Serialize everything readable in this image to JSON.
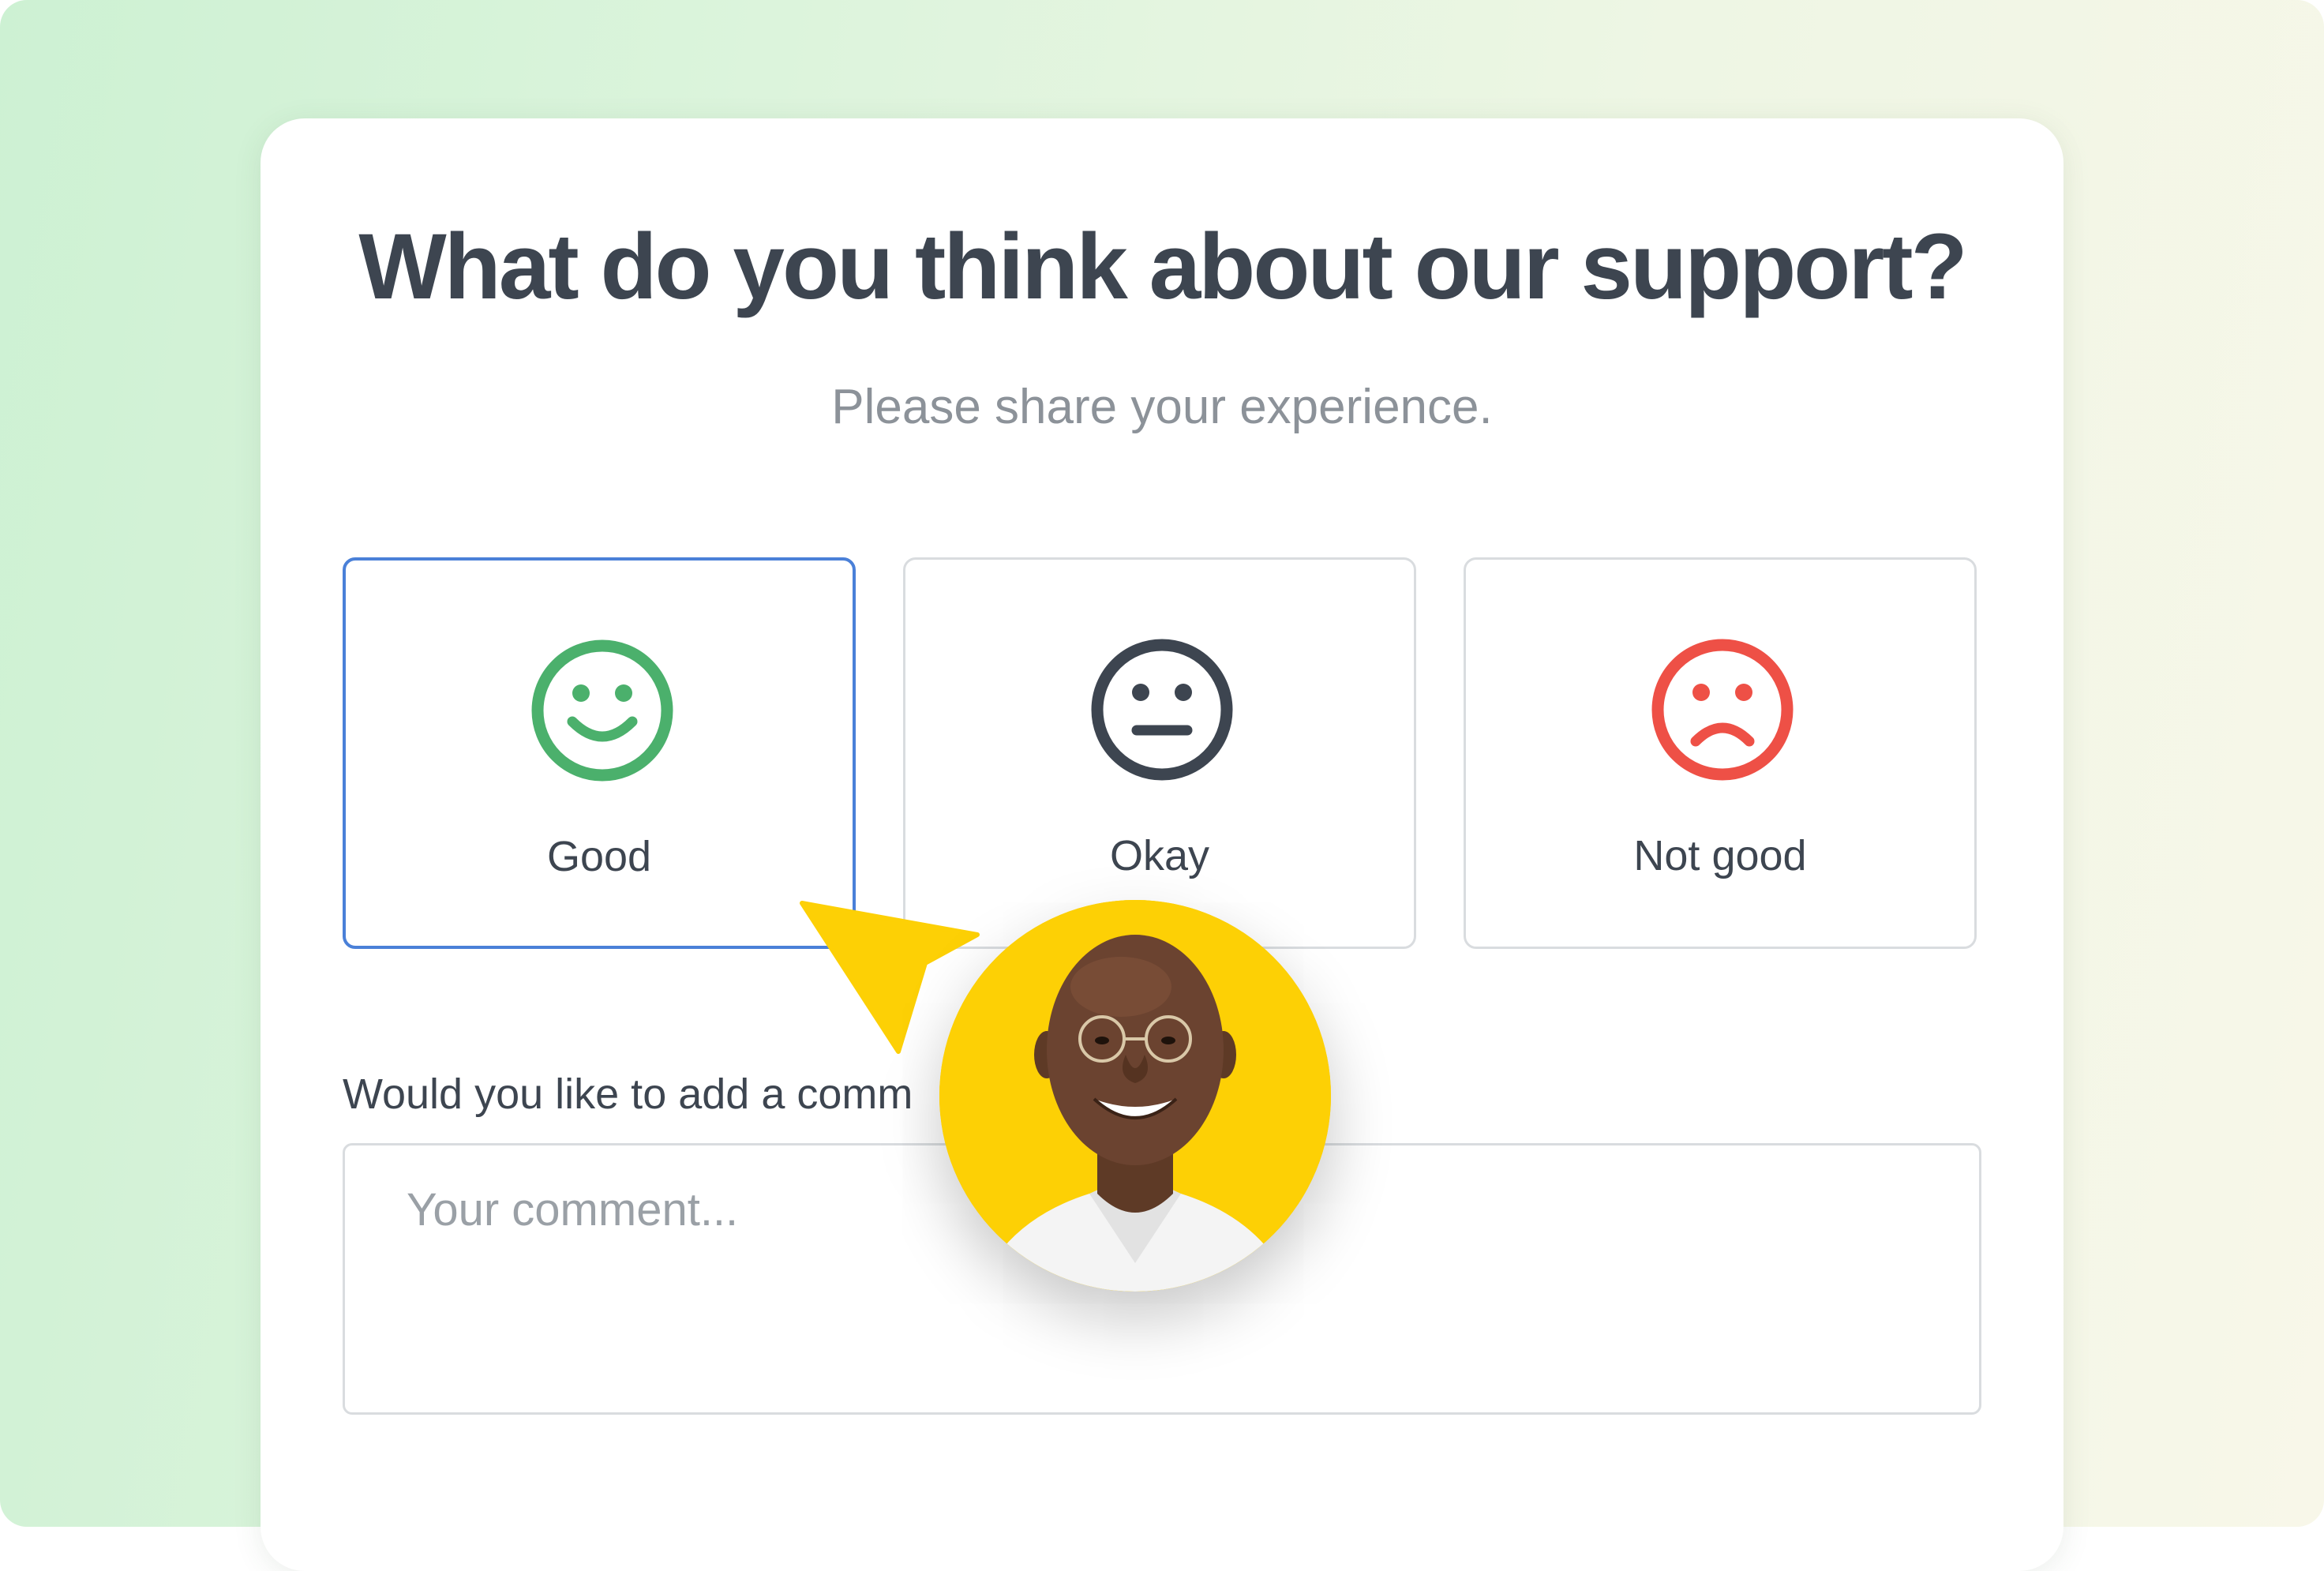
{
  "survey": {
    "title": "What do you think about our support?",
    "subtitle": "Please share your experience.",
    "options": [
      {
        "label": "Good",
        "icon": "smiley-happy-icon",
        "color": "#4bb06c",
        "selected": true
      },
      {
        "label": "Okay",
        "icon": "smiley-neutral-icon",
        "color": "#3d4550",
        "selected": false
      },
      {
        "label": "Not good",
        "icon": "smiley-sad-icon",
        "color": "#ee5046",
        "selected": false
      }
    ],
    "comment_label": "Would you like to add a comm",
    "comment_placeholder": "Your comment..."
  },
  "colors": {
    "selected_border": "#4a80d8",
    "cursor": "#fdd005",
    "avatar_background": "#fdd005"
  }
}
